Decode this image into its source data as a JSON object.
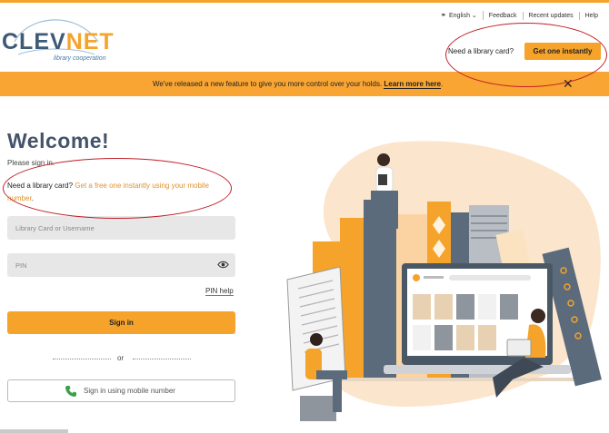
{
  "header": {
    "logo": {
      "main": "CLEVNET",
      "sub": "library cooperation"
    },
    "utility_nav": [
      {
        "label": "English",
        "icon": "globe-icon"
      },
      {
        "label": "Feedback"
      },
      {
        "label": "Recent updates"
      },
      {
        "label": "Help"
      }
    ],
    "card_prompt": "Need a library card?",
    "get_card_button": "Get one instantly"
  },
  "banner": {
    "text": "We've released a new feature to give you more control over your holds.",
    "link": "Learn more here",
    "trailing": "."
  },
  "login": {
    "title": "Welcome!",
    "subtitle": "Please sign in.",
    "need_card_label": "Need a library card?",
    "need_card_link": "Get a free one instantly using your mobile number",
    "need_card_trailing": ".",
    "username_placeholder": "Library Card or Username",
    "pin_placeholder": "PIN",
    "pin_help": "PIN help",
    "sign_in_button": "Sign in",
    "or_text": "or",
    "mobile_button": "Sign in using mobile number"
  },
  "colors": {
    "accent": "#f5a32a",
    "banner": "#f9a533",
    "heading": "#44546a",
    "annotation": "#c0202a",
    "phone_icon": "#3aa04a"
  }
}
